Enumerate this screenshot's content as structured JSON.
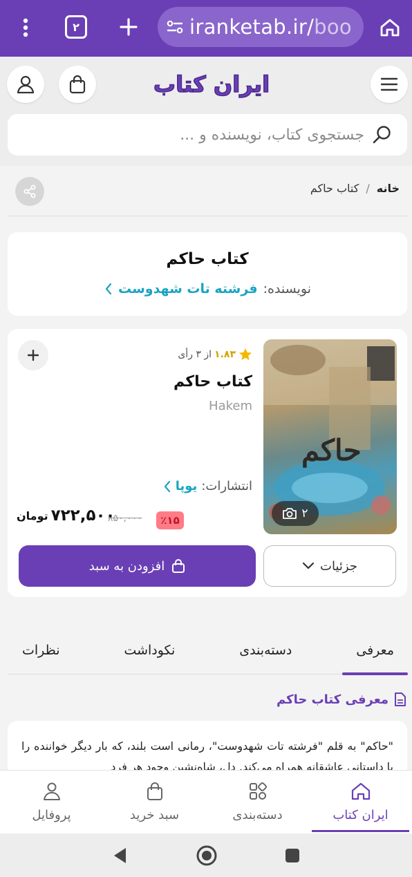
{
  "browser": {
    "tab_count": "۲",
    "url_main": "iranketab.ir/",
    "url_rest": "boo"
  },
  "site": {
    "logo_text": "ایران کتاب",
    "search_placeholder": "جستجوی کتاب، نویسنده و ..."
  },
  "breadcrumb": {
    "home": "خانه",
    "separator": "/",
    "current": "کتاب حاکم"
  },
  "title_card": {
    "title": "کتاب حاکم",
    "author_label": "نویسنده:",
    "author_name": "فرشته تات شهدوست"
  },
  "product": {
    "rating_value": "۱.۸۳",
    "rating_suffix": "از ۳ رأی",
    "title": "کتاب حاکم",
    "subtitle": "Hakem",
    "publisher_label": "انتشارات:",
    "publisher_name": "یوپا",
    "discount": "٪۱۵",
    "old_price": "۸۵۰,۰۰۰",
    "new_price": "۷۲۲,۵۰۰",
    "currency": "تومان",
    "photo_count": "۲",
    "add_to_cart_label": "افزودن به سبد",
    "details_label": "جزئیات"
  },
  "tabs": [
    {
      "label": "معرفی",
      "active": true
    },
    {
      "label": "دسته‌بندی",
      "active": false
    },
    {
      "label": "نکوداشت",
      "active": false
    },
    {
      "label": "نظرات",
      "active": false
    }
  ],
  "intro": {
    "heading": "معرفی کتاب حاکم",
    "text": "\"حاکم\" به قلم \"فرشته تات شهدوست\"، رمانی است بلند، که بار دیگر خواننده را با داستانی عاشقانه همراه می‌کند. دل، شاه‌نشین وجود هر فرد"
  },
  "bottom_nav": [
    {
      "label": "ایران کتاب",
      "icon": "home-icon",
      "active": true
    },
    {
      "label": "دسته‌بندی",
      "icon": "category-icon",
      "active": false
    },
    {
      "label": "سبد خرید",
      "icon": "cart-icon",
      "active": false
    },
    {
      "label": "پروفایل",
      "icon": "profile-icon",
      "active": false
    }
  ],
  "colors": {
    "brand": "#6a3fb5",
    "link": "#1aa3c4",
    "discount_bg": "#ff7b86"
  }
}
